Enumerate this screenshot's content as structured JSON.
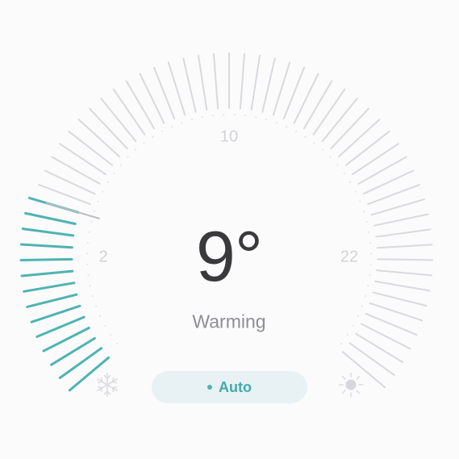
{
  "thermostat": {
    "temperature": "9°",
    "status": "Warming",
    "mode": "Auto",
    "setpoint_fraction": 0.22,
    "scale_labels": {
      "low": "2",
      "mid": "10",
      "high": "22"
    }
  },
  "icons": {
    "cool": "snowflake-icon",
    "heat": "sun-icon"
  },
  "colors": {
    "active_tick": "#4fb3b3",
    "inactive_tick": "#d9d9de",
    "temperature": "#3a3a3c",
    "status": "#8e8e93",
    "mode_pill_bg": "#e8f2f4",
    "mode_text": "#43a9ab"
  }
}
